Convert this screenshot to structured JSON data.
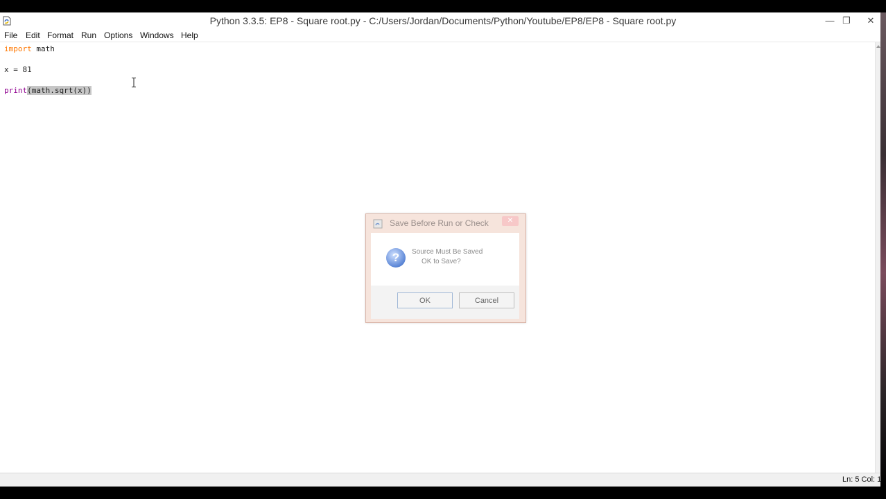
{
  "window": {
    "title": "Python 3.3.5: EP8 - Square root.py - C:/Users/Jordan/Documents/Python/Youtube/EP8/EP8 - Square root.py",
    "controls": {
      "minimize": "—",
      "restore": "❐",
      "close": "✕"
    }
  },
  "menu": [
    "File",
    "Edit",
    "Format",
    "Run",
    "Options",
    "Windows",
    "Help"
  ],
  "editor": {
    "line1": {
      "keyword": "import",
      "rest": " math"
    },
    "line3": "x = 81",
    "line5": {
      "keyword": "print",
      "selected": "(math.sqrt(x))"
    }
  },
  "status": "Ln: 5 Col: 1",
  "dialog": {
    "title": "Save Before Run or Check",
    "icon": "question-icon",
    "message_line1": "Source Must Be Saved",
    "message_line2": "OK to Save?",
    "ok_label": "OK",
    "cancel_label": "Cancel",
    "close_glyph": "✕"
  },
  "colors": {
    "keyword_import": "#ff7700",
    "keyword_print": "#900090",
    "selection": "#c6c6c6"
  }
}
